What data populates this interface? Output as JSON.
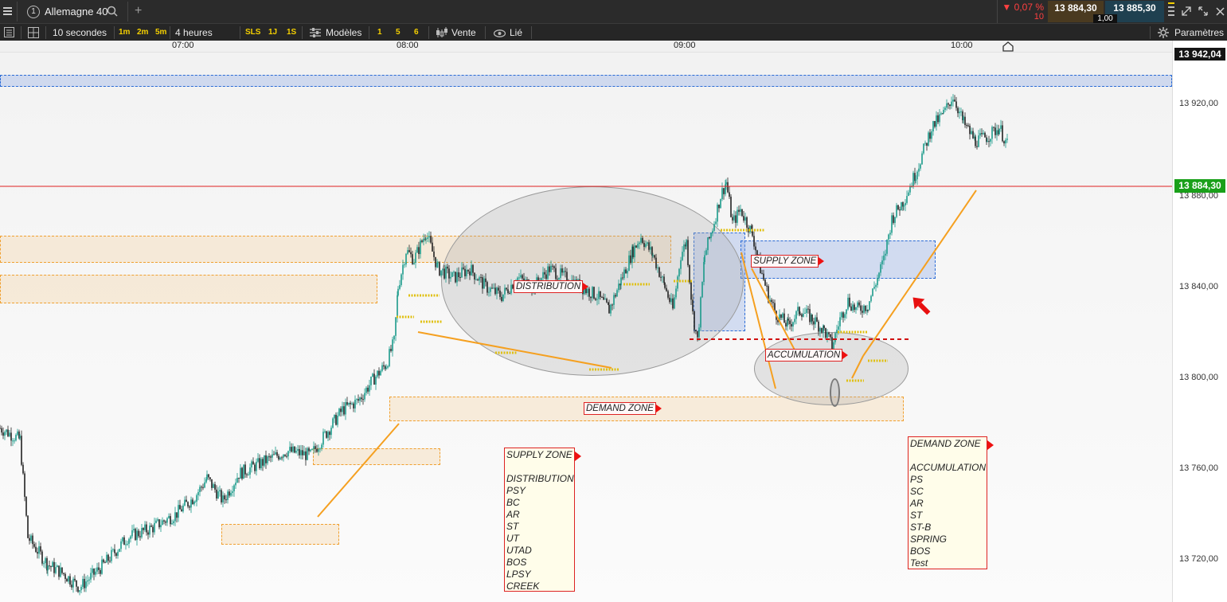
{
  "top": {
    "menu_icon": "hamburger-icon",
    "instrument_number": "1",
    "instrument": "Allemagne 40",
    "change_pct": "▼ 0,07 %",
    "change_pts": "10",
    "bid": "13 884,30",
    "ask": "13 885,30",
    "spread": "1,00"
  },
  "toolbar": {
    "interval": "10 secondes",
    "quick_1m": "1m",
    "quick_2m": "2m",
    "quick_5m": "5m",
    "range": "4 heures",
    "sls": "SLS",
    "j1": "1J",
    "s1": "1S",
    "templates": "Modèles",
    "n1": "1",
    "n5": "5",
    "n6": "6",
    "sell": "Vente",
    "linked": "Lié",
    "settings": "Paramètres"
  },
  "time_axis": [
    "07:00",
    "08:00",
    "09:00",
    "10:00"
  ],
  "price_axis": [
    "13 920,00",
    "13 880,00",
    "13 840,00",
    "13 800,00",
    "13 760,00",
    "13 720,00"
  ],
  "top_price_badge": "13 942,04",
  "current_price_badge": "13 884,30",
  "colors": {
    "current_price_line": "#e02020",
    "current_price_badge": "#1aa01a",
    "up_candle": "#1a9a8a",
    "down_candle": "#222222",
    "trendline": "#f5a020",
    "zone_orange": "#f0a030",
    "zone_blue": "#2a6bd6"
  },
  "labels": {
    "distribution": "DISTRIBUTION",
    "supply_zone": "SUPPLY ZONE",
    "accumulation": "ACCUMULATION",
    "demand_zone": "DEMAND ZONE"
  },
  "notes": {
    "supply": {
      "title": "SUPPLY ZONE",
      "lines": [
        "DISTRIBUTION",
        "PSY",
        "BC",
        "AR",
        "ST",
        "UT",
        "UTAD",
        "BOS",
        "LPSY",
        "CREEK"
      ]
    },
    "demand": {
      "title": "DEMAND ZONE",
      "lines": [
        "ACCUMULATION",
        "PS",
        "SC",
        "AR",
        "ST",
        "ST-B",
        "SPRING",
        "BOS",
        "Test"
      ]
    }
  },
  "chart_data": {
    "type": "candlestick",
    "instrument": "Allemagne 40",
    "interval": "10 secondes",
    "x_ticks": [
      "07:00",
      "08:00",
      "09:00",
      "10:00"
    ],
    "y_ticks": [
      13920,
      13880,
      13840,
      13800,
      13760,
      13720
    ],
    "last_price": 13884.3,
    "top_marker": 13942.04,
    "series": [
      {
        "values": [
          [
            0,
            13760
          ],
          [
            25,
            13755
          ],
          [
            35,
            13712
          ],
          [
            60,
            13700
          ],
          [
            80,
            13696
          ],
          [
            100,
            13690
          ],
          [
            130,
            13700
          ],
          [
            160,
            13712
          ],
          [
            190,
            13716
          ],
          [
            220,
            13722
          ],
          [
            245,
            13730
          ],
          [
            260,
            13738
          ],
          [
            280,
            13728
          ],
          [
            300,
            13740
          ],
          [
            330,
            13745
          ],
          [
            360,
            13750
          ],
          [
            390,
            13748
          ],
          [
            410,
            13758
          ],
          [
            430,
            13768
          ],
          [
            450,
            13772
          ],
          [
            470,
            13782
          ],
          [
            485,
            13788
          ],
          [
            495,
            13798
          ],
          [
            500,
            13822
          ],
          [
            510,
            13838
          ],
          [
            520,
            13834
          ],
          [
            535,
            13846
          ],
          [
            550,
            13830
          ],
          [
            570,
            13826
          ],
          [
            590,
            13830
          ],
          [
            610,
            13822
          ],
          [
            630,
            13818
          ],
          [
            650,
            13826
          ],
          [
            670,
            13822
          ],
          [
            690,
            13830
          ],
          [
            710,
            13826
          ],
          [
            730,
            13822
          ],
          [
            750,
            13818
          ],
          [
            765,
            13812
          ],
          [
            780,
            13825
          ],
          [
            795,
            13838
          ],
          [
            805,
            13844
          ],
          [
            820,
            13836
          ],
          [
            835,
            13822
          ],
          [
            845,
            13812
          ],
          [
            855,
            13836
          ],
          [
            862,
            13842
          ],
          [
            870,
            13810
          ],
          [
            876,
            13798
          ],
          [
            885,
            13836
          ],
          [
            895,
            13848
          ],
          [
            905,
            13862
          ],
          [
            912,
            13868
          ],
          [
            920,
            13850
          ],
          [
            930,
            13856
          ],
          [
            945,
            13845
          ],
          [
            955,
            13830
          ],
          [
            965,
            13818
          ],
          [
            975,
            13810
          ],
          [
            990,
            13805
          ],
          [
            1005,
            13812
          ],
          [
            1020,
            13808
          ],
          [
            1035,
            13803
          ],
          [
            1045,
            13796
          ],
          [
            1055,
            13808
          ],
          [
            1065,
            13816
          ],
          [
            1075,
            13812
          ],
          [
            1090,
            13814
          ],
          [
            1100,
            13824
          ],
          [
            1110,
            13834
          ],
          [
            1120,
            13852
          ],
          [
            1135,
            13860
          ],
          [
            1150,
            13872
          ],
          [
            1160,
            13882
          ],
          [
            1170,
            13892
          ],
          [
            1185,
            13898
          ],
          [
            1197,
            13906
          ],
          [
            1210,
            13894
          ],
          [
            1225,
            13886
          ],
          [
            1240,
            13888
          ],
          [
            1255,
            13892
          ],
          [
            1265,
            13884.3
          ]
        ]
      }
    ]
  }
}
